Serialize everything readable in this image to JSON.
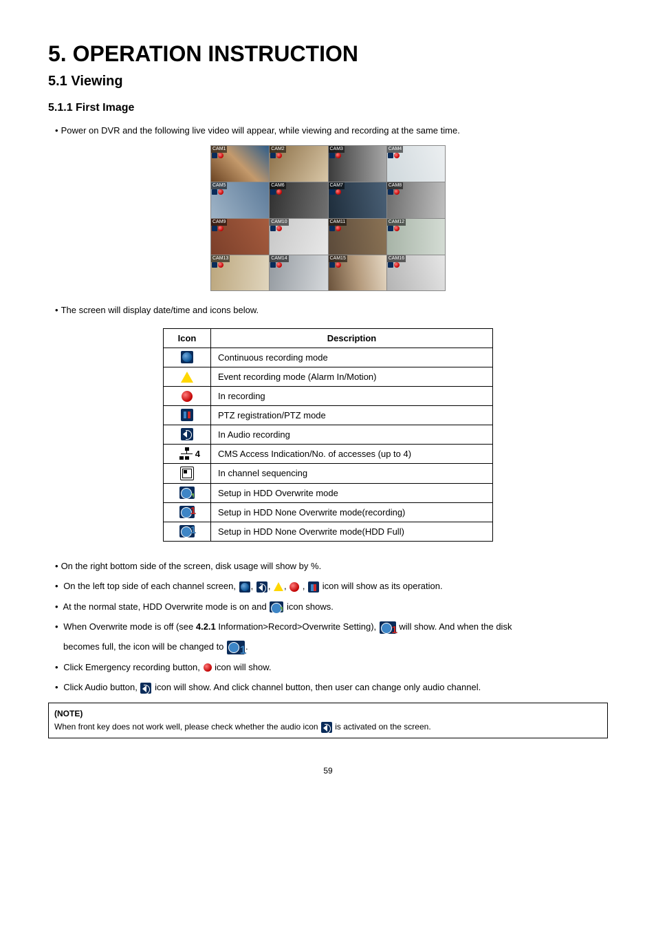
{
  "heading": "5.  OPERATION INSTRUCTION",
  "sub_heading": "5.1  Viewing",
  "subsub_heading": "5.1.1    First Image",
  "intro_bullet": "Power on DVR and the following live video will appear, while viewing and recording at the same time.",
  "cams": [
    "CAM1",
    "CAM2",
    "CAM3",
    "CAM4",
    "CAM5",
    "CAM6",
    "CAM7",
    "CAM8",
    "CAM9",
    "CAM10",
    "CAM11",
    "CAM12",
    "CAM13",
    "CAM14",
    "CAM15",
    "CAM16"
  ],
  "screen_bullet": "The screen will display date/time and icons below.",
  "table": {
    "head_icon": "Icon",
    "head_desc": "Description",
    "rows": [
      "Continuous recording mode",
      "Event recording mode (Alarm In/Motion)",
      "In recording",
      "PTZ registration/PTZ mode",
      "In Audio recording",
      "CMS Access Indication/No. of accesses (up to 4)",
      "In channel sequencing",
      "Setup in HDD Overwrite mode",
      "Setup in HDD None Overwrite mode(recording)",
      "Setup in HDD None Overwrite mode(HDD Full)"
    ]
  },
  "cms_digit": "4",
  "hdd_digit": "1",
  "body": {
    "b1": "On the right bottom side of the screen, disk usage will show by %.",
    "b2a": "On the left top side of each channel screen, ",
    "b2b": " icon will show as its operation.",
    "b3a": "At the normal state, HDD Overwrite mode is on and ",
    "b3b": " icon shows.",
    "b4a": "When Overwrite mode is off (see ",
    "b4bold": "4.2.1",
    "b4b": " Information>Record>Overwrite Setting), ",
    "b4c": " will show. And when the disk",
    "b4d": "becomes full, the icon will be changed to",
    "b4e": ".",
    "b5a": "Click Emergency recording button,   ",
    "b5b": " icon will show.",
    "b6a": "Click Audio button, ",
    "b6b": " icon will show. And click channel button, then user can change only audio channel."
  },
  "note": {
    "title": "(NOTE)",
    "line_a": "When front key does not work well, please check whether the audio icon ",
    "line_b": " is activated on the screen."
  },
  "page_number": "59"
}
